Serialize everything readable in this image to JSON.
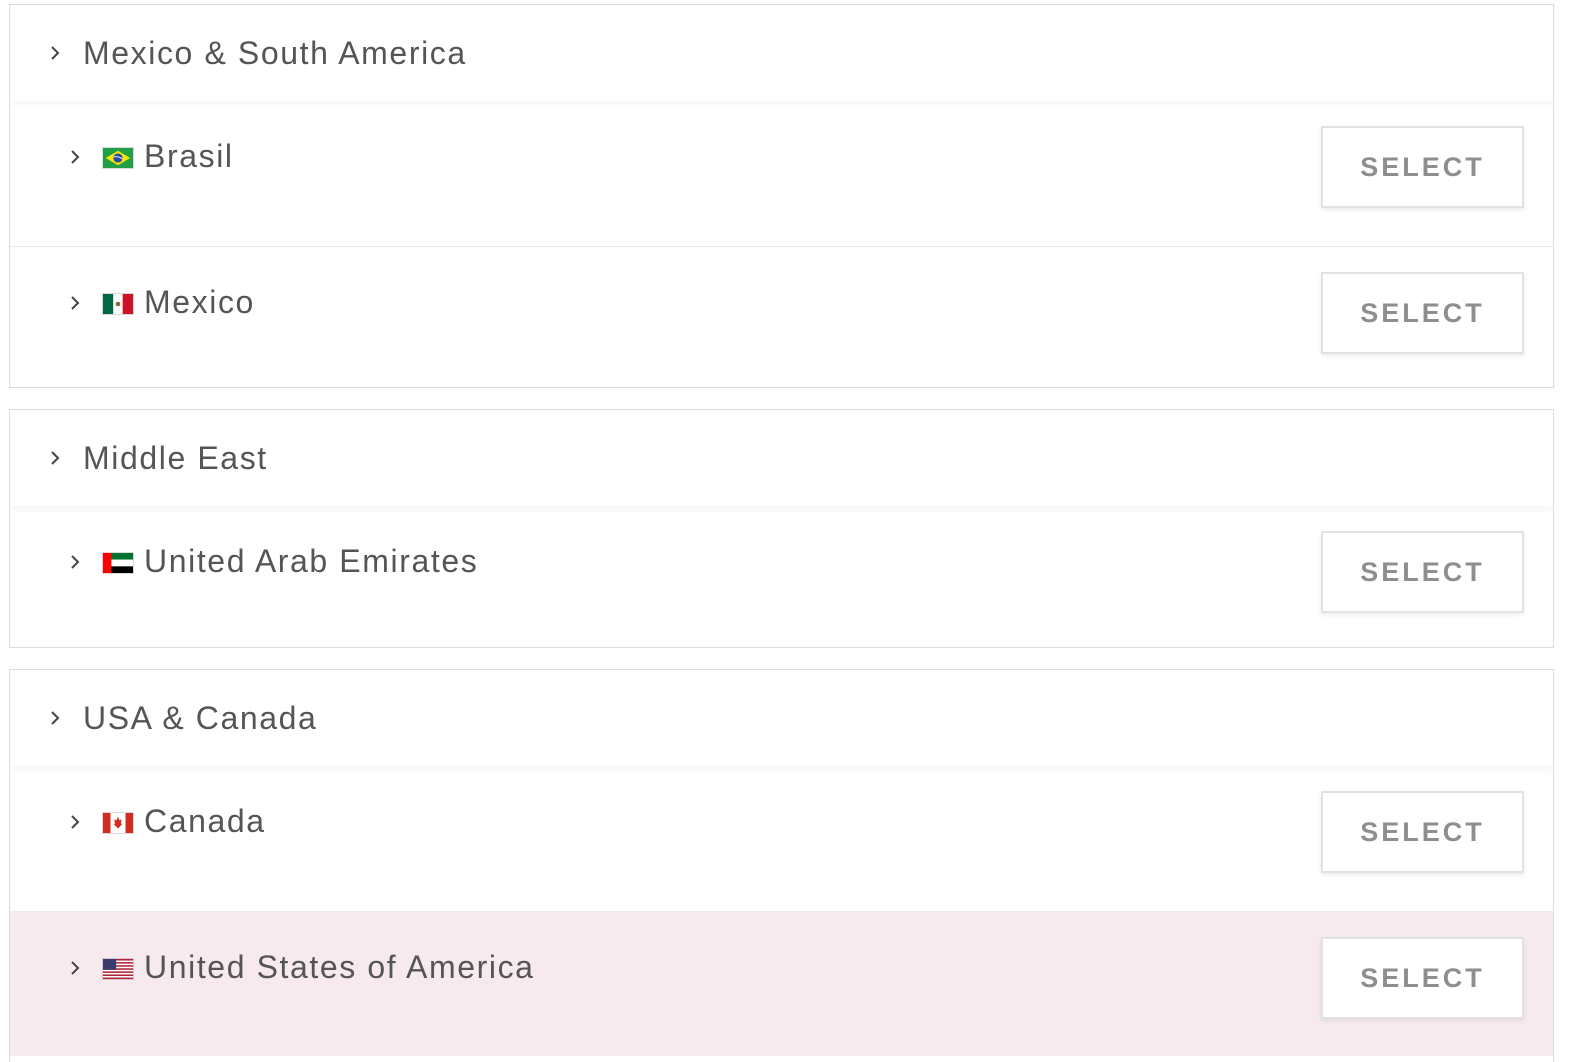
{
  "regions": [
    {
      "name": "Mexico & South America",
      "countries": [
        {
          "name": "Brasil",
          "flag_icon": "brazil-flag-icon",
          "button_label": "SELECT",
          "highlighted": false
        },
        {
          "name": "Mexico",
          "flag_icon": "mexico-flag-icon",
          "button_label": "SELECT",
          "highlighted": false
        }
      ]
    },
    {
      "name": "Middle East",
      "countries": [
        {
          "name": "United Arab Emirates",
          "flag_icon": "uae-flag-icon",
          "button_label": "SELECT",
          "highlighted": false
        }
      ]
    },
    {
      "name": "USA & Canada",
      "countries": [
        {
          "name": "Canada",
          "flag_icon": "canada-flag-icon",
          "button_label": "SELECT",
          "highlighted": false
        },
        {
          "name": "United States of America",
          "flag_icon": "usa-flag-icon",
          "button_label": "SELECT",
          "highlighted": true
        }
      ]
    }
  ],
  "colors": {
    "text": "#555555",
    "button_text": "#8e8e8e",
    "border": "#dcdcdc",
    "highlight_row": "#f6eaee"
  }
}
